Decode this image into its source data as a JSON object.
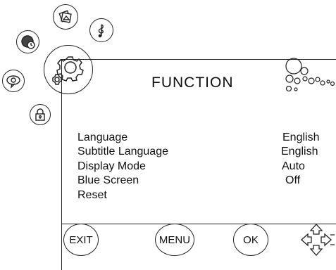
{
  "header": {
    "title": "FUNCTION"
  },
  "nav_icons": [
    "picture-icon",
    "music-icon",
    "clock-icon",
    "settings-icon",
    "speech-icon",
    "lock-icon"
  ],
  "menu": {
    "items": [
      {
        "label": "Language",
        "value": "English"
      },
      {
        "label": "Subtitle Language",
        "value": "English"
      },
      {
        "label": "Display Mode",
        "value": "Auto"
      },
      {
        "label": "Blue Screen",
        "value": "Off"
      },
      {
        "label": "Reset",
        "value": ""
      }
    ]
  },
  "footer": {
    "exit_label": "EXIT",
    "menu_label": "MENU",
    "ok_label": "OK",
    "dpad_icon": "dpad-arrows-icon"
  }
}
